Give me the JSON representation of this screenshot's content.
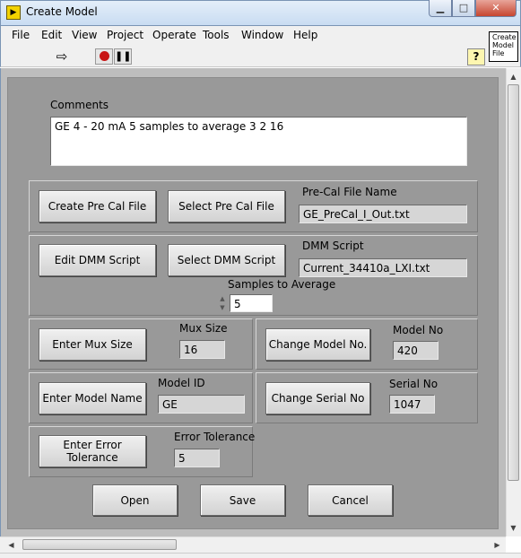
{
  "window": {
    "title": "Create Model",
    "app_icon": "labview-vi-icon",
    "minimize": "▁",
    "maximize": "□",
    "close": "✕"
  },
  "menu": [
    "File",
    "Edit",
    "View",
    "Project",
    "Operate",
    "Tools",
    "Window",
    "Help"
  ],
  "toolbar": {
    "run_icon": "run-arrow-icon",
    "abort_icon": "abort-icon",
    "pause_icon": "pause-icon",
    "help_label": "?",
    "connector_icon_text": "Create Model File"
  },
  "comments": {
    "label": "Comments",
    "value": "GE 4 - 20 mA 5 samples to average 3 2 16"
  },
  "precal": {
    "create_button": "Create Pre Cal File",
    "select_button": "Select Pre Cal File",
    "file_label": "Pre-Cal File Name",
    "file_value": "GE_PreCal_I_Out.txt"
  },
  "dmm": {
    "edit_button": "Edit DMM Script",
    "select_button": "Select DMM Script",
    "script_label": "DMM Script",
    "script_value": "Current_34410a_LXI.txt",
    "samples_label": "Samples to Average",
    "samples_value": "5"
  },
  "mux": {
    "button": "Enter Mux Size",
    "label": "Mux Size",
    "value": "16"
  },
  "model_no": {
    "button": "Change Model No.",
    "label": "Model No",
    "value": "420"
  },
  "model_id": {
    "button": "Enter Model Name",
    "label": "Model ID",
    "value": "GE"
  },
  "serial": {
    "button": "Change Serial No",
    "label": "Serial No",
    "value": "1047"
  },
  "error": {
    "button": "Enter Error Tolerance",
    "label": "Error Tolerance",
    "value": "5"
  },
  "actions": {
    "open": "Open",
    "save": "Save",
    "cancel": "Cancel"
  }
}
